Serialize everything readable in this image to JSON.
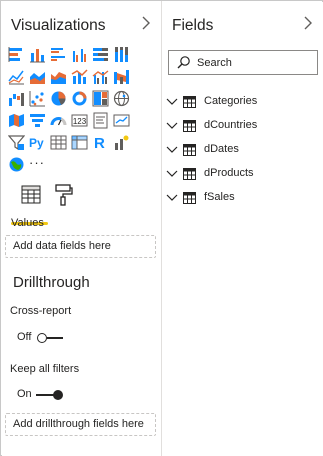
{
  "visualizations": {
    "title": "Visualizations",
    "build_tab_icon": "table-grid-icon",
    "format_tab_icon": "paint-roller-icon",
    "more_label": "···",
    "py_label": "Py",
    "r_label": "R",
    "values_label": "Values",
    "values_dropzone": "Add data fields here",
    "drillthrough": {
      "title": "Drillthrough",
      "cross_report_label": "Cross-report",
      "cross_report_state": "Off",
      "keep_filters_label": "Keep all filters",
      "keep_filters_state": "On",
      "dropzone": "Add drillthrough fields here"
    }
  },
  "fields": {
    "title": "Fields",
    "search_placeholder": "Search",
    "tables": [
      {
        "name": "Categories"
      },
      {
        "name": "dCountries"
      },
      {
        "name": "dDates"
      },
      {
        "name": "dProducts"
      },
      {
        "name": "fSales"
      }
    ]
  },
  "colors": {
    "accent_yellow": "#f2c811",
    "icon_blue": "#118dff",
    "icon_orange": "#e66c37",
    "icon_dark": "#252423"
  }
}
